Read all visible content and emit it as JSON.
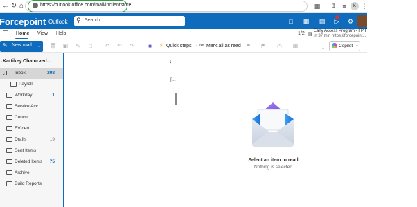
{
  "browser": {
    "back_icon": "arrow-left-icon",
    "reload_icon": "reload-icon",
    "home_icon": "home-icon",
    "url": "https://outlook.office.com/mail/inclientstore"
  },
  "header": {
    "brand": "Forcepoint",
    "app_name": "Outlook",
    "search_placeholder": "Search"
  },
  "ribbon": {
    "tabs": [
      "Home",
      "View",
      "Help"
    ],
    "pager": "1/2",
    "notice_title": "Early Access Program - FP F...",
    "notice_sub": "in 37 min https://forcepoint..."
  },
  "toolbar": {
    "new_mail_label": "New mail",
    "quick_steps_label": "Quick steps",
    "mark_read_label": "Mark all as read",
    "copilot_label": "Copilot"
  },
  "folders": {
    "account": "Kartikey.Chaturved...",
    "items": [
      {
        "label": "Inbox",
        "count": "298"
      },
      {
        "label": "Payroll",
        "count": ""
      },
      {
        "label": "Workday",
        "count": "1"
      },
      {
        "label": "Service Acc",
        "count": ""
      },
      {
        "label": "Concur",
        "count": ""
      },
      {
        "label": "EV cert",
        "count": ""
      },
      {
        "label": "Drafts",
        "count": "19"
      },
      {
        "label": "Sent Items",
        "count": ""
      },
      {
        "label": "Deleted Items",
        "count": "75"
      },
      {
        "label": "Archive",
        "count": ""
      },
      {
        "label": "Build Reports",
        "count": ""
      }
    ]
  },
  "reading_pane": {
    "title": "Select an item to read",
    "subtitle": "Nothing is selected"
  },
  "colors": {
    "brand_blue": "#0f6cbd",
    "url_highlight": "#2e9b3e"
  }
}
